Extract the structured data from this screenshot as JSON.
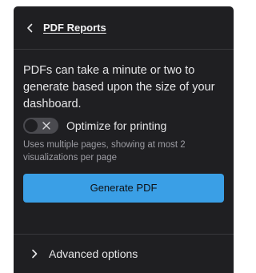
{
  "header": {
    "title": "PDF Reports",
    "back_icon": "chevron-left-icon"
  },
  "main": {
    "description": "PDFs can take a minute or two to generate based upon the size of your dashboard.",
    "optimize_toggle": {
      "label": "Optimize for printing",
      "state": "off",
      "icon": "close-icon"
    },
    "helper_text": "Uses multiple pages, showing at most 2 visualizations per page",
    "generate_button": "Generate PDF"
  },
  "footer": {
    "advanced_label": "Advanced options",
    "expand_icon": "chevron-right-icon"
  },
  "colors": {
    "panel_bg": "#1f1f22",
    "accent": "#3a9fe6",
    "text": "#e6e6e8",
    "muted_text": "#9c9ca3",
    "divider": "#38383c"
  }
}
